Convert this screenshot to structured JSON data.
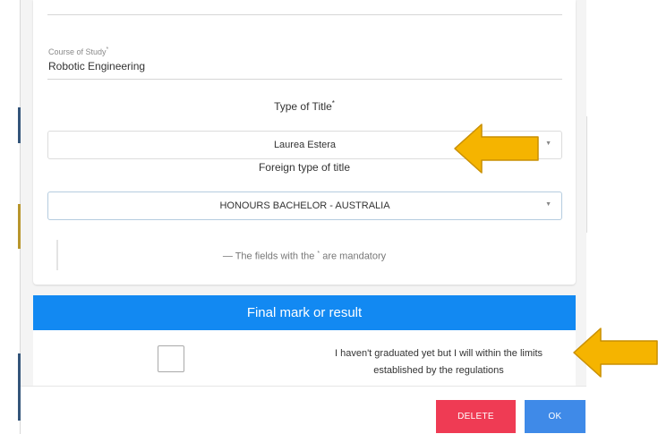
{
  "form": {
    "course_label": "Course of Study",
    "course_value": "Robotic Engineering",
    "type_title_label": "Type of Title",
    "type_title_value": "Laurea Estera",
    "foreign_title_label": "Foreign type of title",
    "foreign_title_value": "HONOURS BACHELOR - AUSTRALIA",
    "mandatory_prefix": "— The fields with the",
    "mandatory_suffix": "are mandatory",
    "asterisk": "*"
  },
  "result": {
    "header": "Final mark or result",
    "checkbox_line1": "I haven't graduated yet but I will within the limits",
    "checkbox_line2": "established by the regulations"
  },
  "footer": {
    "delete_label": "DELETE",
    "ok_label": "OK"
  },
  "colors": {
    "accent_blue": "#1289f2",
    "delete_red": "#ef3b54",
    "ok_blue": "#3f8ae8",
    "arrow_gold": "#f5b400"
  },
  "icons": {
    "select_chevron": "chevron-down-icon",
    "annotation_arrow": "arrow-left-icon"
  }
}
